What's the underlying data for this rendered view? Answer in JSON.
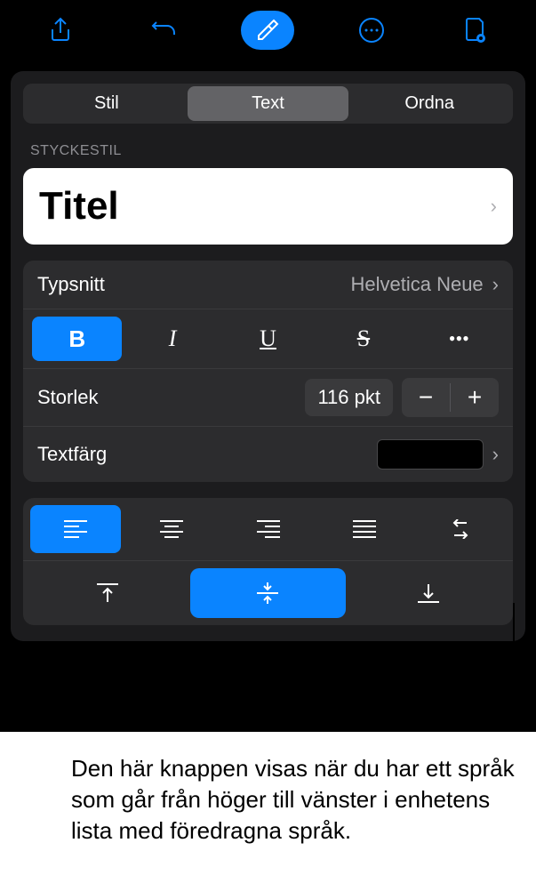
{
  "toolbar": {
    "share": "share-icon",
    "undo": "undo-icon",
    "format": "format-brush-icon",
    "more": "more-icon",
    "doc": "document-icon"
  },
  "tabs": {
    "style": "Stil",
    "text": "Text",
    "arrange": "Ordna"
  },
  "section_label": "STYCKESTIL",
  "paragraph_style": {
    "title": "Titel"
  },
  "font": {
    "label": "Typsnitt",
    "value": "Helvetica Neue"
  },
  "format_buttons": {
    "bold": "B",
    "italic": "I",
    "underline": "U",
    "strike": "S",
    "more": "•••"
  },
  "size": {
    "label": "Storlek",
    "value": "116 pkt",
    "minus": "−",
    "plus": "+"
  },
  "text_color": {
    "label": "Textfärg",
    "value": "#000000"
  },
  "caption": "Den här knappen visas när du har ett språk som går från höger till vänster i enhetens lista med föredragna språk."
}
